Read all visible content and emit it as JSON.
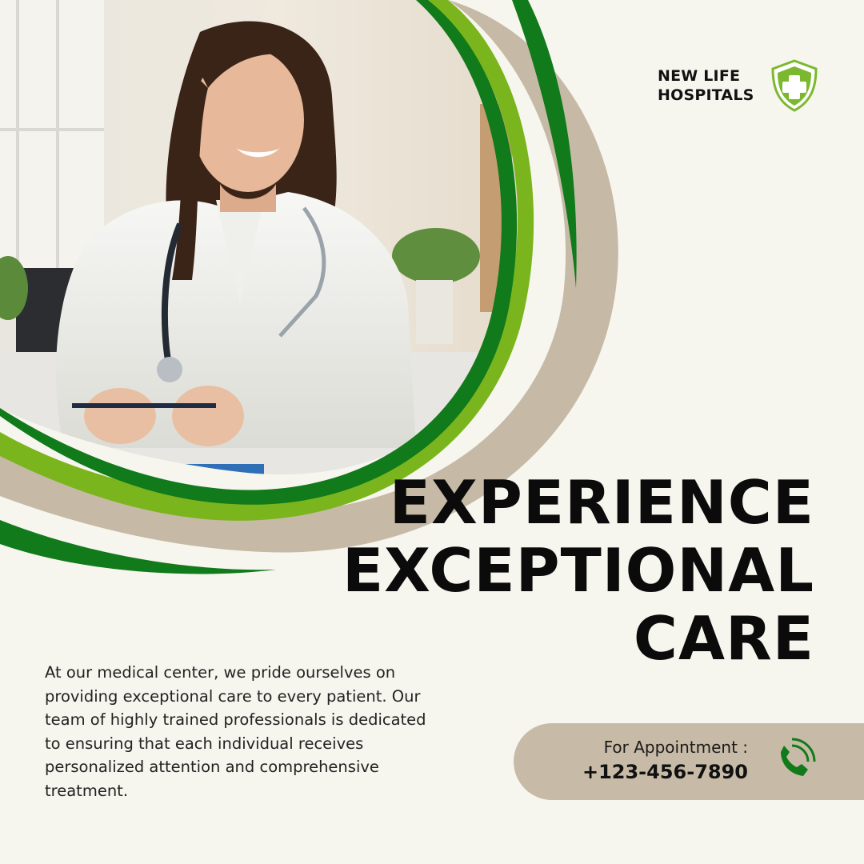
{
  "brand": {
    "name": "NEW LIFE HOSPITALS",
    "logo_icon": "shield-cross-icon",
    "accent": "#7cb82f",
    "dark_green": "#117a1a"
  },
  "hero": {
    "photo": "doctor-smiling-photo",
    "arc_colors": [
      "#117a1a",
      "#7ab51d",
      "#c6baa6"
    ]
  },
  "headline": {
    "line1": "EXPERIENCE",
    "line2": "EXCEPTIONAL",
    "line3": "CARE"
  },
  "body": "At our medical center, we pride ourselves on providing exceptional care to every patient. Our team of highly trained professionals is dedicated to ensuring that each individual receives personalized attention and comprehensive treatment.",
  "appointment": {
    "label": "For Appointment :",
    "phone": "+123-456-7890",
    "icon": "phone-icon"
  },
  "colors": {
    "background": "#f6f5ee",
    "beige": "#c7bba7",
    "text": "#0b0b0b"
  }
}
